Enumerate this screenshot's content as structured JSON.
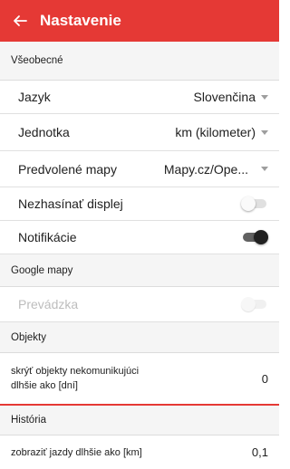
{
  "appbar": {
    "title": "Nastavenie",
    "back_icon": "arrow-back-icon"
  },
  "sections": {
    "general": "Všeobecné",
    "google": "Google mapy",
    "objects": "Objekty",
    "history": "História"
  },
  "language": {
    "label": "Jazyk",
    "value": "Slovenčina"
  },
  "unit": {
    "label": "Jednotka",
    "value": "km (kilometer)"
  },
  "default_map": {
    "label": "Predvolené mapy",
    "value": "Mapy.cz/Ope..."
  },
  "keep_screen_on": {
    "label": "Nezhasínať displej",
    "checked": false
  },
  "notifications": {
    "label": "Notifikácie",
    "checked": true
  },
  "traffic": {
    "label": "Prevádzka",
    "checked": false,
    "enabled": false
  },
  "hide_objects": {
    "label_line1": "skrýť objekty nekomunikujúci",
    "label_line2": "dlhšie ako [dní]",
    "value": "0"
  },
  "show_trips": {
    "label": "zobraziť jazdy dlhšie ako [km]",
    "value": "0,1"
  },
  "colors": {
    "accent": "#e53935",
    "toggle_on": "#212121"
  }
}
